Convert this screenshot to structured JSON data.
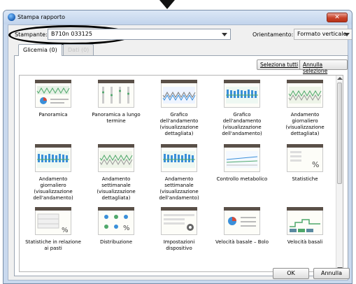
{
  "window": {
    "title": "Stampa rapporto",
    "close_glyph": "✕"
  },
  "printer": {
    "label": "Stampante:",
    "value": "B710n 033125"
  },
  "orientation": {
    "label": "Orientamento:",
    "value": "Formato verticale"
  },
  "tabs": [
    {
      "label": "Glicemia (0)"
    },
    {
      "label": "Dati (0)"
    }
  ],
  "buttons": {
    "select_all": "Seleziona tutti",
    "deselect_all": "Annulla selezione",
    "ok": "OK",
    "cancel": "Annulla"
  },
  "reports": [
    {
      "label": "Panoramica",
      "icon": "overview-report-icon"
    },
    {
      "label": "Panoramica a lungo termine",
      "icon": "long-term-overview-icon"
    },
    {
      "label": "Grafico dell'andamento (visualizzazione dettagliata)",
      "icon": "trend-graph-detailed-icon"
    },
    {
      "label": "Grafico dell'andamento (visualizzazione dell'andamento)",
      "icon": "trend-graph-trend-icon"
    },
    {
      "label": "Andamento giornaliero (visualizzazione dettagliata)",
      "icon": "daily-trend-detailed-icon"
    },
    {
      "label": "Andamento giornaliero (visualizzazione dell'andamento)",
      "icon": "daily-trend-trend-icon"
    },
    {
      "label": "Andamento settimanale (visualizzazione dettagliata)",
      "icon": "weekly-trend-detailed-icon"
    },
    {
      "label": "Andamento settimanale (visualizzazione dell'andamento)",
      "icon": "weekly-trend-trend-icon"
    },
    {
      "label": "Controllo metabolico",
      "icon": "metabolic-control-icon"
    },
    {
      "label": "Statistiche",
      "icon": "statistics-icon"
    },
    {
      "label": "Statistiche in relazione ai pasti",
      "icon": "meal-statistics-icon"
    },
    {
      "label": "Distribuzione",
      "icon": "distribution-icon"
    },
    {
      "label": "Impostazioni dispositivo",
      "icon": "device-settings-icon"
    },
    {
      "label": "Velocità basale – Bolo",
      "icon": "basal-bolus-icon"
    },
    {
      "label": "Velocità basali",
      "icon": "basal-rates-icon"
    }
  ],
  "colors": {
    "accent_blue": "#3a8fd9",
    "graph_green": "#4fa86a",
    "header_dark": "#5a5048",
    "close_red": "#c7432a"
  }
}
